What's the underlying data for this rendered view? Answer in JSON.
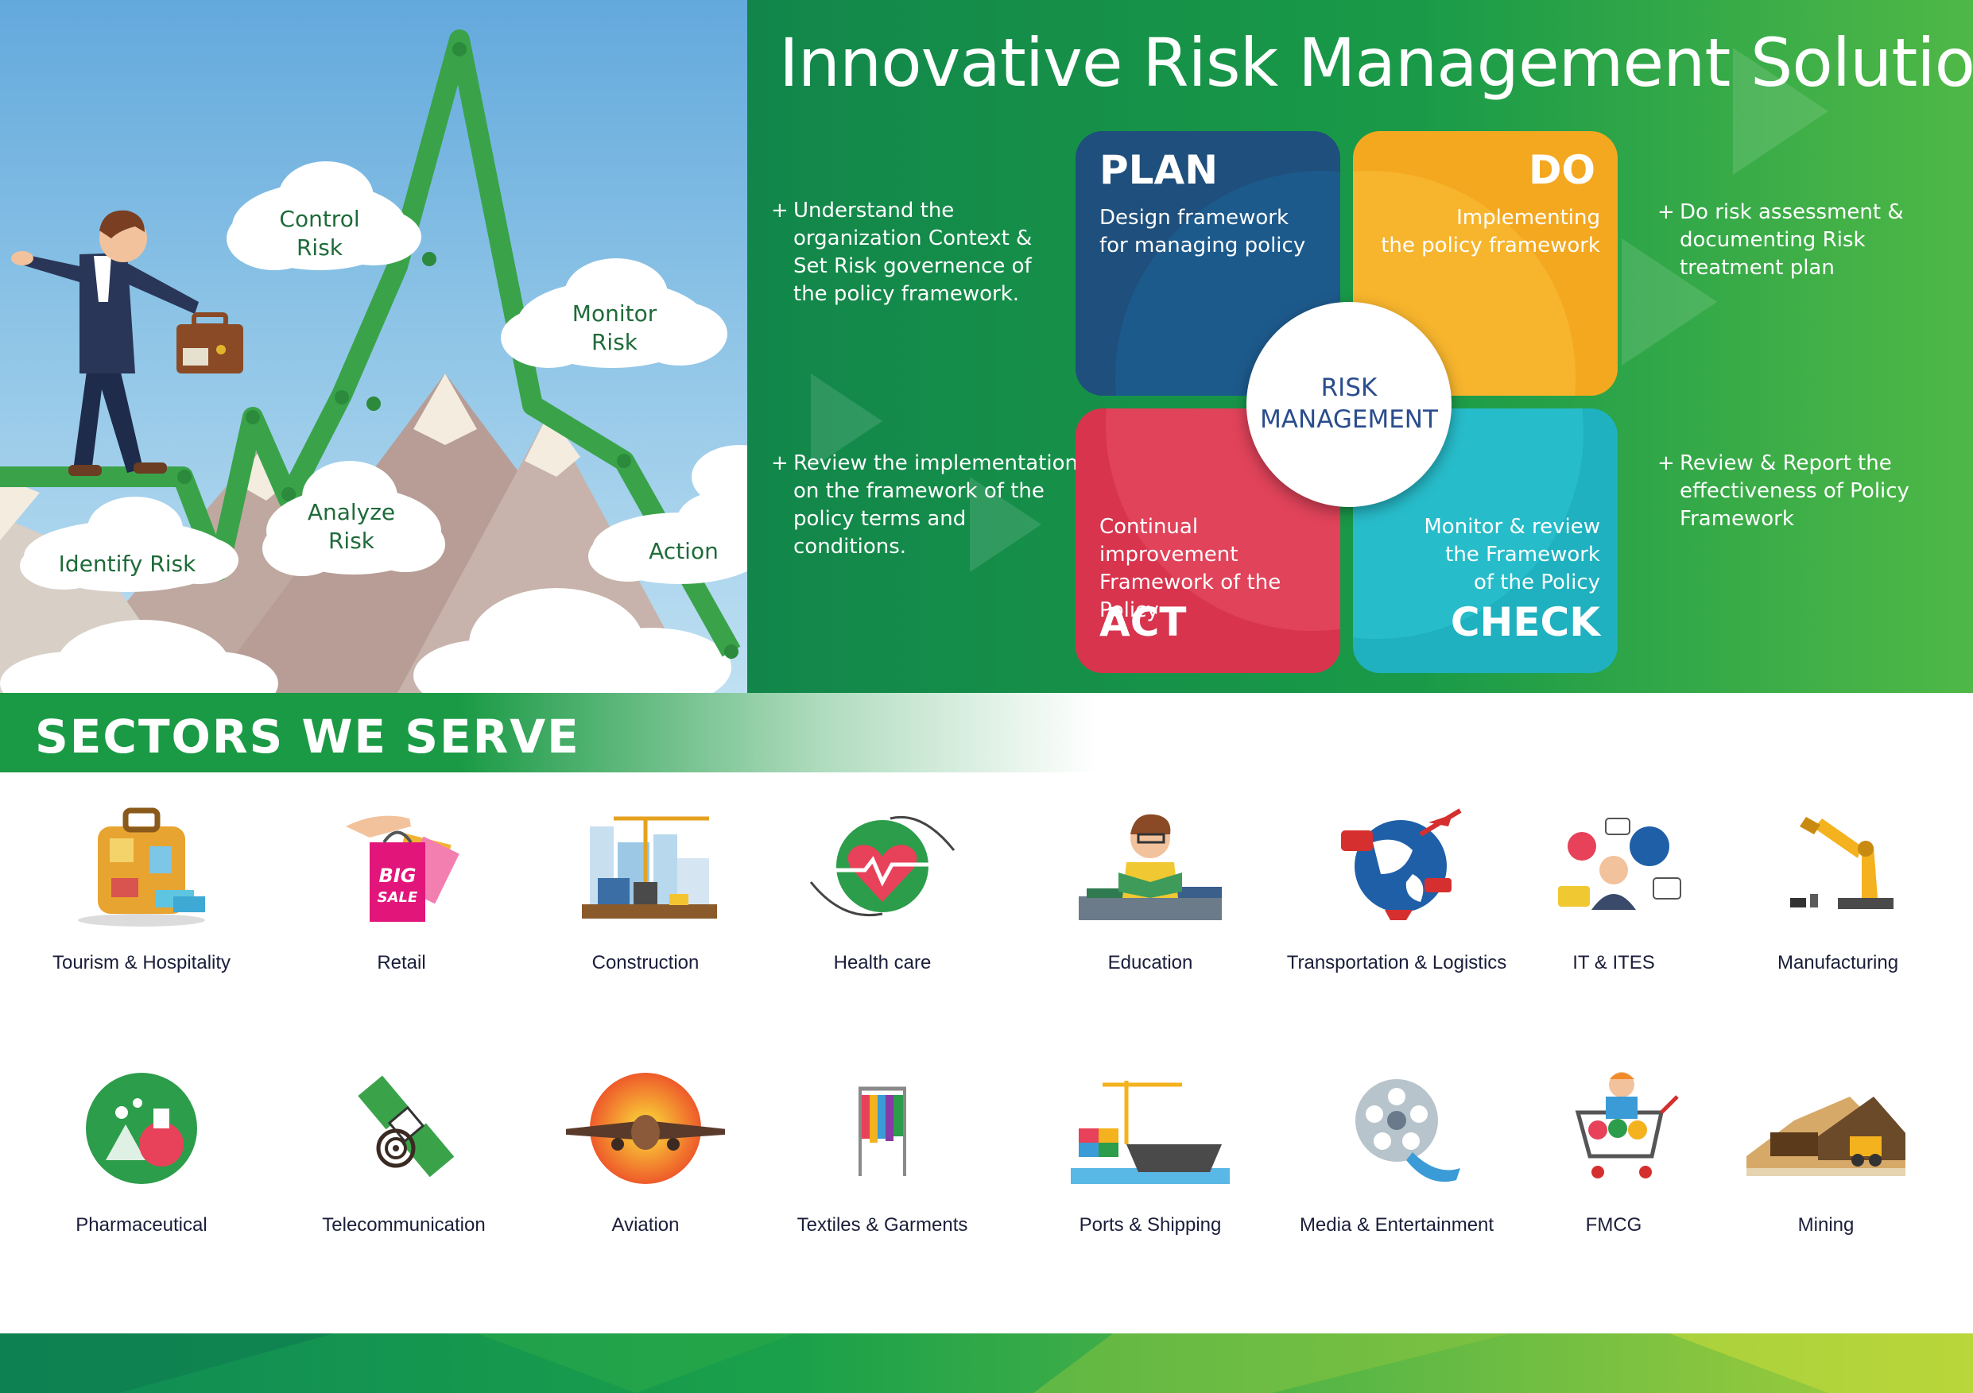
{
  "illustration": {
    "clouds": [
      {
        "key": "control",
        "label": [
          "Control",
          "Risk"
        ]
      },
      {
        "key": "monitor",
        "label": [
          "Monitor",
          "Risk"
        ]
      },
      {
        "key": "analyze",
        "label": [
          "Analyze",
          "Risk"
        ]
      },
      {
        "key": "identify",
        "label": [
          "Identify Risk"
        ]
      },
      {
        "key": "action",
        "label": [
          "Action"
        ]
      }
    ]
  },
  "header": {
    "title": "Innovative Risk Management Solutions"
  },
  "cycle": {
    "center": [
      "RISK",
      "MANAGEMENT"
    ],
    "plan": {
      "title": "PLAN",
      "text": [
        "Design framework",
        "for managing policy"
      ]
    },
    "do": {
      "title": "DO",
      "text": [
        "Implementing",
        "the policy framework"
      ]
    },
    "act": {
      "title": "ACT",
      "text": [
        "Continual improvement",
        "Framework of the",
        "Policy"
      ]
    },
    "check": {
      "title": "CHECK",
      "text": [
        "Monitor & review",
        "the Framework",
        "of the Policy"
      ]
    }
  },
  "bullets": {
    "plan": {
      "symbol": "+",
      "lines": [
        "Understand the",
        "organization Context &",
        "Set Risk governence of",
        "the policy framework."
      ]
    },
    "act": {
      "symbol": "+",
      "lines": [
        "Review the implementation",
        "on the framework of the",
        "policy terms and conditions."
      ]
    },
    "do": {
      "symbol": "+",
      "lines": [
        "Do risk assessment &",
        "documenting Risk",
        "treatment plan"
      ]
    },
    "check": {
      "symbol": "+",
      "lines": [
        "Review & Report the",
        "effectiveness of Policy",
        "Framework"
      ]
    }
  },
  "sectors": {
    "title": "SECTORS WE SERVE",
    "items": [
      {
        "label": "Tourism & Hospitality",
        "icon": "suitcase-icon"
      },
      {
        "label": "Retail",
        "icon": "shopping-bags-icon"
      },
      {
        "label": "Construction",
        "icon": "building-crane-icon"
      },
      {
        "label": "Health care",
        "icon": "heart-hands-icon"
      },
      {
        "label": "Education",
        "icon": "student-books-icon"
      },
      {
        "label": "Transportation & Logistics",
        "icon": "globe-vehicles-icon"
      },
      {
        "label": "IT & ITES",
        "icon": "it-network-icon"
      },
      {
        "label": "Manufacturing",
        "icon": "robot-arm-icon"
      },
      {
        "label": "Pharmaceutical",
        "icon": "lab-flask-icon"
      },
      {
        "label": "Telecommunication",
        "icon": "satellite-icon"
      },
      {
        "label": "Aviation",
        "icon": "airplane-icon"
      },
      {
        "label": "Textiles & Garments",
        "icon": "clothes-rack-icon"
      },
      {
        "label": "Ports & Shipping",
        "icon": "cargo-ship-icon"
      },
      {
        "label": "Media & Entertainment",
        "icon": "film-reel-icon"
      },
      {
        "label": "FMCG",
        "icon": "shopping-cart-icon"
      },
      {
        "label": "Mining",
        "icon": "mining-truck-icon"
      }
    ]
  },
  "big_sale_text": [
    "BIG",
    "SALE"
  ]
}
